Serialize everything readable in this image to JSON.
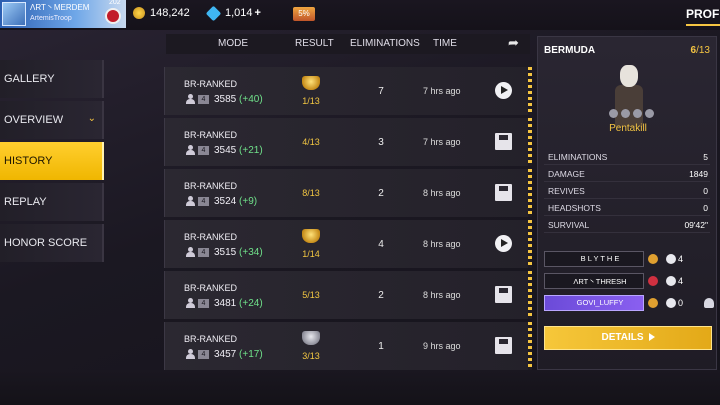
{
  "topbar": {
    "player_name": "ΛRT丶MERDEM",
    "clan_name": "ArtemisTroop",
    "level": "202",
    "coins": "148,242",
    "diamonds": "1,014",
    "diamonds_plus": "+",
    "store_label": "5%",
    "profile_tab": "PROFIL"
  },
  "sidebar": {
    "items": [
      {
        "label": "GALLERY"
      },
      {
        "label": "OVERVIEW"
      },
      {
        "label": "HISTORY"
      },
      {
        "label": "REPLAY"
      },
      {
        "label": "HONOR SCORE"
      }
    ],
    "active": "HISTORY"
  },
  "history": {
    "columns": {
      "mode": "MODE",
      "result": "RESULT",
      "eliminations": "ELIMINATIONS",
      "time": "TIME"
    },
    "matches": [
      {
        "mode": "BR-RANKED",
        "squad": "4",
        "points": "3585",
        "delta": "(+40)",
        "result": "1/13",
        "trophy": "gold",
        "eliminations": "7",
        "time": "7 hrs ago",
        "action": "play"
      },
      {
        "mode": "BR-RANKED",
        "squad": "4",
        "points": "3545",
        "delta": "(+21)",
        "result": "4/13",
        "trophy": "none",
        "eliminations": "3",
        "time": "7 hrs ago",
        "action": "save"
      },
      {
        "mode": "BR-RANKED",
        "squad": "4",
        "points": "3524",
        "delta": "(+9)",
        "result": "8/13",
        "trophy": "none",
        "eliminations": "2",
        "time": "8 hrs ago",
        "action": "save"
      },
      {
        "mode": "BR-RANKED",
        "squad": "4",
        "points": "3515",
        "delta": "(+34)",
        "result": "1/14",
        "trophy": "gold",
        "eliminations": "4",
        "time": "8 hrs ago",
        "action": "play"
      },
      {
        "mode": "BR-RANKED",
        "squad": "4",
        "points": "3481",
        "delta": "(+24)",
        "result": "5/13",
        "trophy": "none",
        "eliminations": "2",
        "time": "8 hrs ago",
        "action": "save"
      },
      {
        "mode": "BR-RANKED",
        "squad": "4",
        "points": "3457",
        "delta": "(+17)",
        "result": "3/13",
        "trophy": "silver",
        "eliminations": "1",
        "time": "9 hrs ago",
        "action": "save"
      }
    ]
  },
  "detail": {
    "map": "BERMUDA",
    "rank_place": "6",
    "rank_total": "/13",
    "achievement": "Pentakill",
    "stats": [
      {
        "label": "ELIMINATIONS",
        "value": "5"
      },
      {
        "label": "DAMAGE",
        "value": "1849"
      },
      {
        "label": "REVIVES",
        "value": "0"
      },
      {
        "label": "HEADSHOTS",
        "value": "0"
      },
      {
        "label": "SURVIVAL",
        "value": "09'42\""
      }
    ],
    "players": [
      {
        "name": "B L Y T H E",
        "kills": "4",
        "highlight": false
      },
      {
        "name": "ΛRT丶THRESH",
        "kills": "4",
        "highlight": false
      },
      {
        "name": "GOVI_LUFFY",
        "kills": "0",
        "highlight": true
      }
    ],
    "details_button": "DETAILS"
  },
  "colors": {
    "accent": "#f5c542",
    "positive": "#6fe08a",
    "active_sidebar": "#f6c01c"
  }
}
